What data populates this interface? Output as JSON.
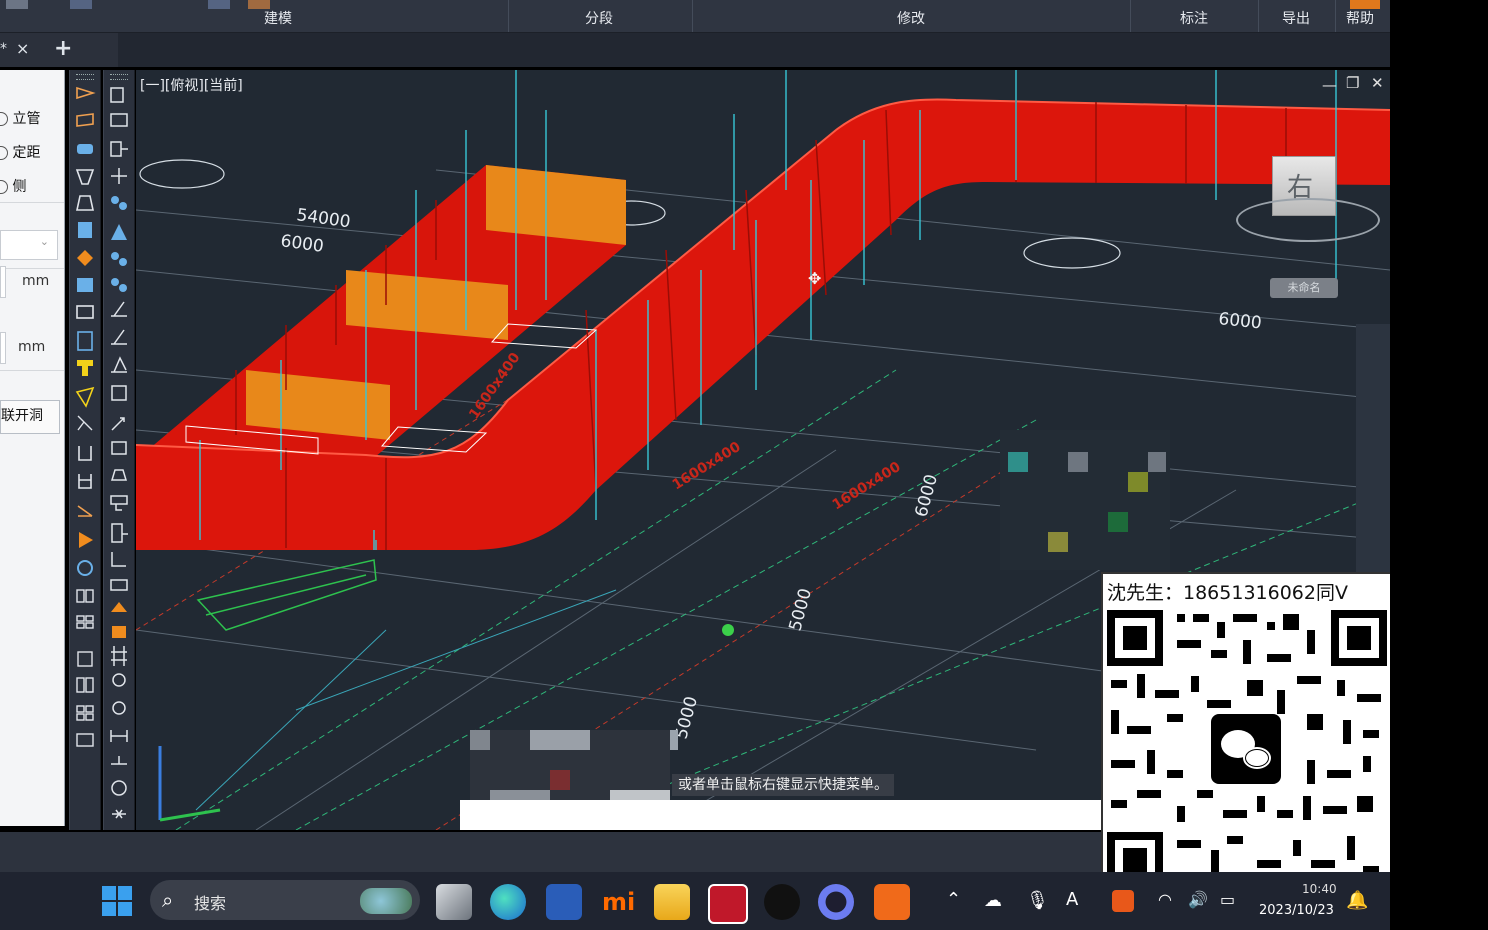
{
  "ribbon": {
    "tabs": [
      "建模",
      "分段",
      "修改",
      "标注",
      "导出",
      "帮助"
    ]
  },
  "doc_tabs": {
    "active_marker": "*",
    "close_symbol": "×",
    "add_symbol": "+"
  },
  "left_panel": {
    "radio_items": [
      "立管",
      "定距",
      "侧"
    ],
    "unit1": "mm",
    "unit2": "mm",
    "link_button": "联开洞"
  },
  "viewport": {
    "label": "[一][俯视][当前]",
    "view_cube_label": "右",
    "view_name_tag": "未命名",
    "dim_texts": [
      "54000",
      "6000",
      "6000",
      "6000",
      "5000",
      "5000"
    ],
    "hint_text": "或者单击鼠标右键显示快捷菜单。"
  },
  "overlay": {
    "contact_text": "沈先生：18651316062同V"
  },
  "taskbar": {
    "search_placeholder": "搜索",
    "time": "10:40",
    "date": "2023/10/23"
  },
  "colors": {
    "duct_red": "#e0160c",
    "duct_orange": "#e8881a",
    "viewport_bg": "#212933",
    "cyan_line": "#37c6d6"
  }
}
